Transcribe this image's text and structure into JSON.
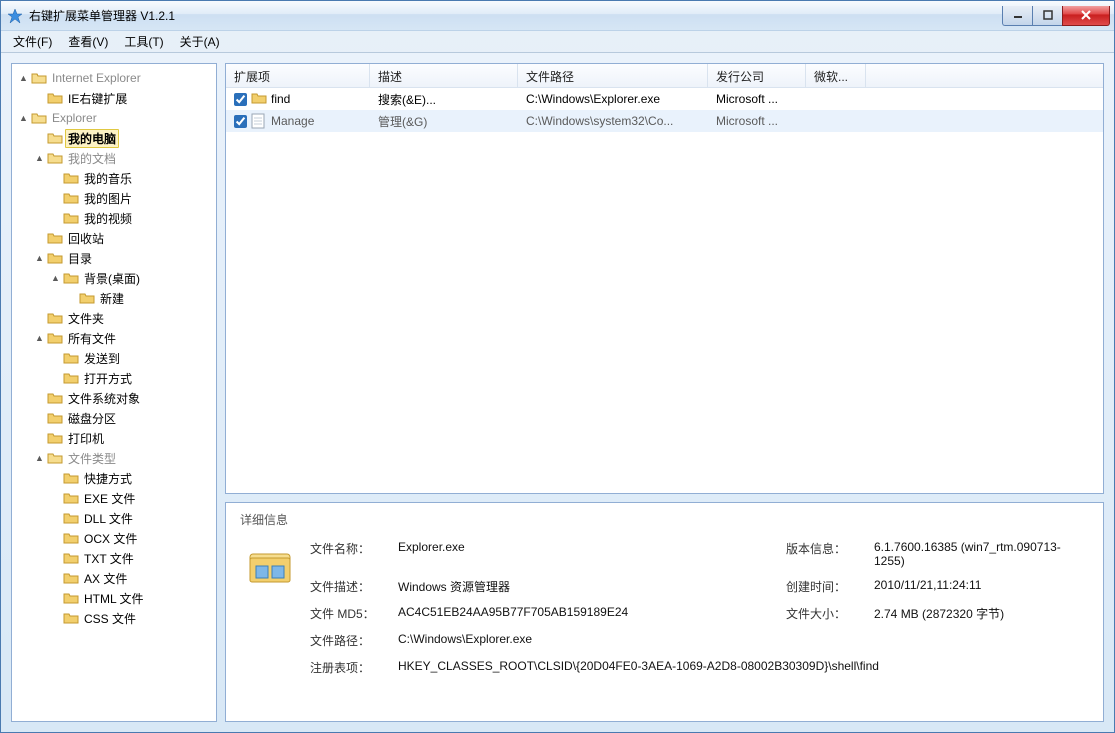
{
  "window": {
    "title": "右键扩展菜单管理器 V1.2.1"
  },
  "menu": {
    "file": "文件(F)",
    "view": "查看(V)",
    "tools": "工具(T)",
    "about": "关于(A)"
  },
  "tree": {
    "ie_root": "Internet Explorer",
    "ie_ext": "IE右键扩展",
    "explorer_root": "Explorer",
    "my_computer": "我的电脑",
    "my_docs": "我的文档",
    "my_music": "我的音乐",
    "my_pics": "我的图片",
    "my_videos": "我的视频",
    "recycle": "回收站",
    "directory": "目录",
    "background": "背景(桌面)",
    "new_item": "新建",
    "folder": "文件夹",
    "all_files": "所有文件",
    "send_to": "发送到",
    "open_with": "打开方式",
    "fs_objects": "文件系统对象",
    "disk_part": "磁盘分区",
    "printer": "打印机",
    "file_types": "文件类型",
    "ft_shortcut": "快捷方式",
    "ft_exe": "EXE 文件",
    "ft_dll": "DLL 文件",
    "ft_ocx": "OCX 文件",
    "ft_txt": "TXT 文件",
    "ft_ax": "AX 文件",
    "ft_html": "HTML 文件",
    "ft_css": "CSS 文件"
  },
  "list": {
    "columns": {
      "ext": "扩展项",
      "desc": "描述",
      "path": "文件路径",
      "company": "发行公司",
      "ms": "微软..."
    },
    "widths": {
      "ext": 144,
      "desc": 148,
      "path": 190,
      "company": 98,
      "ms": 60
    },
    "rows": [
      {
        "checked": true,
        "icon": "folder",
        "name": "find",
        "desc": "搜索(&E)...",
        "path": "C:\\Windows\\Explorer.exe",
        "company": "Microsoft ...",
        "ms": "",
        "selected": false
      },
      {
        "checked": true,
        "icon": "doc",
        "name": "Manage",
        "desc": "管理(&G)",
        "path": "C:\\Windows\\system32\\Co...",
        "company": "Microsoft ...",
        "ms": "",
        "selected": true
      }
    ]
  },
  "detail": {
    "title": "详细信息",
    "labels": {
      "filename": "文件名称：",
      "filedesc": "文件描述：",
      "md5": "文件 MD5：",
      "filepath": "文件路径：",
      "regkey": "注册表项：",
      "version": "版本信息：",
      "created": "创建时间：",
      "size": "文件大小："
    },
    "values": {
      "filename": "Explorer.exe",
      "filedesc": "Windows 资源管理器",
      "md5": "AC4C51EB24AA95B77F705AB159189E24",
      "filepath": "C:\\Windows\\Explorer.exe",
      "regkey": "HKEY_CLASSES_ROOT\\CLSID\\{20D04FE0-3AEA-1069-A2D8-08002B30309D}\\shell\\find",
      "version": "6.1.7600.16385 (win7_rtm.090713-1255)",
      "created": "2010/11/21,11:24:11",
      "size": "2.74 MB (2872320 字节)"
    }
  }
}
